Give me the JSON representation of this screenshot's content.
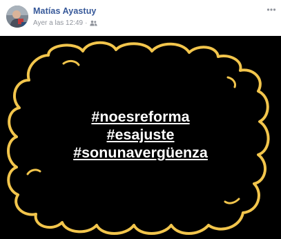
{
  "post": {
    "author": "Matías Ayastuy",
    "timestamp": "Ayer a las 12:49",
    "separator": "·",
    "audience_icon": "friends-icon",
    "more_icon": "more-options-icon"
  },
  "image": {
    "background": "#000000",
    "frame_color": "#f2c54c",
    "hashtags": [
      "#noesreforma",
      "#esajuste",
      "#sonunavergüenza"
    ]
  },
  "colors": {
    "author": "#365899",
    "meta": "#90949c"
  }
}
